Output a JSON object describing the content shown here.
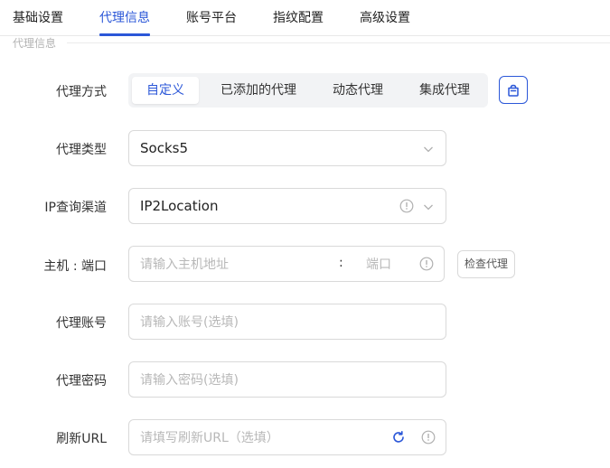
{
  "tabs": [
    {
      "label": "基础设置"
    },
    {
      "label": "代理信息",
      "active": true
    },
    {
      "label": "账号平台"
    },
    {
      "label": "指纹配置"
    },
    {
      "label": "高级设置"
    }
  ],
  "section_title": "代理信息",
  "proxy_method": {
    "label": "代理方式",
    "options": [
      "自定义",
      "已添加的代理",
      "动态代理",
      "集成代理"
    ],
    "selected": "自定义"
  },
  "proxy_type": {
    "label": "代理类型",
    "value": "Socks5"
  },
  "ip_query": {
    "label": "IP查询渠道",
    "value": "IP2Location"
  },
  "host_port": {
    "label": "主机 : 端口",
    "host_placeholder": "请输入主机地址",
    "separator": ":",
    "port_placeholder": "端口",
    "check_button": "检查代理"
  },
  "proxy_account": {
    "label": "代理账号",
    "placeholder": "请输入账号(选填)"
  },
  "proxy_password": {
    "label": "代理密码",
    "placeholder": "请输入密码(选填)"
  },
  "refresh_url": {
    "label": "刷新URL",
    "placeholder": "请填写刷新URL（选填）"
  },
  "colors": {
    "accent": "#2b57d8",
    "border": "#d9d9d9",
    "placeholder": "#b8b8b8",
    "segment_bg": "#f2f3f5"
  },
  "icons": [
    "bag-icon",
    "chevron-down-icon",
    "info-icon",
    "refresh-icon"
  ]
}
